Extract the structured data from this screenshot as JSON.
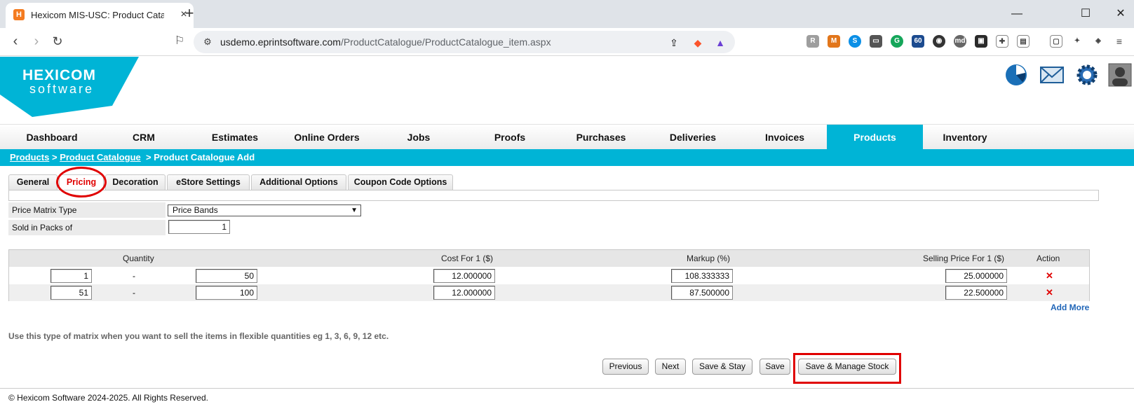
{
  "browser": {
    "tab_title": "Hexicom MIS-USC: Product Catalogue",
    "favicon_letter": "H",
    "url_host": "usdemo.eprintsoftware.com",
    "url_path": "/ProductCatalogue/ProductCatalogue_item.aspx",
    "extension_badge": "60"
  },
  "logo": {
    "line1": "HEXICOM",
    "line2": "software"
  },
  "mainnav": [
    {
      "label": "Dashboard"
    },
    {
      "label": "CRM"
    },
    {
      "label": "Estimates"
    },
    {
      "label": "Online Orders"
    },
    {
      "label": "Jobs"
    },
    {
      "label": "Proofs"
    },
    {
      "label": "Purchases"
    },
    {
      "label": "Deliveries"
    },
    {
      "label": "Invoices"
    },
    {
      "label": "Products"
    },
    {
      "label": "Inventory"
    }
  ],
  "breadcrumb": {
    "link1": "Products",
    "sep1": ">",
    "link2": "Product Catalogue",
    "current": "> Product Catalogue Add"
  },
  "subtabs": [
    {
      "label": "General"
    },
    {
      "label": "Pricing"
    },
    {
      "label": "Decoration"
    },
    {
      "label": "eStore Settings"
    },
    {
      "label": "Additional Options"
    },
    {
      "label": "Coupon Code Options"
    }
  ],
  "form": {
    "price_matrix_label": "Price Matrix Type",
    "price_matrix_value": "Price Bands",
    "packs_label": "Sold in Packs of",
    "packs_value": "1"
  },
  "table": {
    "headers": {
      "quantity": "Quantity",
      "cost": "Cost For 1 ($)",
      "markup": "Markup (%)",
      "selling": "Selling Price For 1 ($)",
      "action": "Action"
    },
    "rows": [
      {
        "from": "1",
        "dash": "-",
        "to": "50",
        "cost": "12.000000",
        "markup": "108.333333",
        "selling": "25.000000"
      },
      {
        "from": "51",
        "dash": "-",
        "to": "100",
        "cost": "12.000000",
        "markup": "87.500000",
        "selling": "22.500000"
      }
    ],
    "add_more": "Add More",
    "delete_glyph": "✕"
  },
  "hint": "Use this type of matrix when you want to sell the items in flexible quantities eg 1, 3, 6, 9, 12 etc.",
  "buttons": {
    "previous": "Previous",
    "next": "Next",
    "save_stay": "Save & Stay",
    "save": "Save",
    "save_manage_stock": "Save & Manage Stock"
  },
  "footer": "© Hexicom Software 2024-2025. All Rights Reserved.",
  "colors": {
    "accent": "#00b4d6",
    "highlight": "#e00000",
    "link": "#2166b8"
  }
}
